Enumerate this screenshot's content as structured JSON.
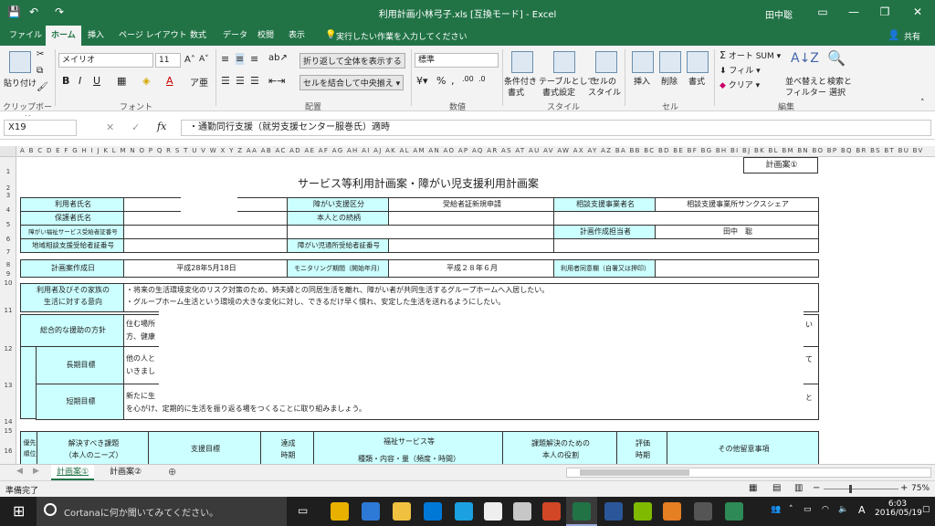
{
  "titlebar": {
    "title": "利用計画小林弓子.xls [互換モード] - Excel",
    "user": "田中聡"
  },
  "tabs": [
    "ファイル",
    "ホーム",
    "挿入",
    "ページ レイアウト",
    "数式",
    "データ",
    "校閲",
    "表示"
  ],
  "tell_me": "実行したい作業を入力してください",
  "share": "共有",
  "ribbon": {
    "paste": "貼り付け",
    "clipboard": "クリップボード",
    "font_name": "メイリオ",
    "font_size": "11",
    "font_group": "フォント",
    "wrap": "折り返して全体を表示する",
    "merge": "セルを結合して中央揃え",
    "align_group": "配置",
    "number_format": "標準",
    "number_group": "数値",
    "cond": "条件付き",
    "cond2": "書式",
    "table": "テーブルとして",
    "table2": "書式設定",
    "cellstyle": "セルの",
    "cellstyle2": "スタイル",
    "style_group": "スタイル",
    "insert": "挿入",
    "delete": "削除",
    "format": "書式",
    "cells_group": "セル",
    "autosum": "オート SUM",
    "fill": "フィル",
    "clear": "クリア",
    "sort": "並べ替えと",
    "sort2": "フィルター",
    "find": "検索と",
    "find2": "選択",
    "edit_group": "編集"
  },
  "formula": {
    "name_box": "X19",
    "fx": "fx",
    "value": "・通勤同行支援（就労支援センター服巻氏）適時"
  },
  "col_headers": "A B C D E F G H I J K L M N O P Q R S T U V W X Y Z AA AB AC AD AE AF AG AH AI AJ AK AL AM AN AO AP AQ AR AS AT AU AV AW AX AY AZ BA BB BC BD BE BF BG BH BI BJ BK BL BM BN BO BP BQ BR BS BT BU BV",
  "rows": [
    "1",
    "2",
    "3",
    "4",
    "5",
    "6",
    "7",
    "8",
    "9",
    "10",
    "11",
    "12",
    "13",
    "14",
    "15",
    "16"
  ],
  "sheet": {
    "plan_label": "計画案①",
    "title": "サービス等利用計画案・障がい児支援利用計画案",
    "user_name": "利用者氏名",
    "guardian": "保護者氏名",
    "welfare_no": "障がい福祉サービス受給者証番号",
    "consult_no": "地域相談支援受給者証番号",
    "disability": "障がい支援区分",
    "applicant": "受給者証新規申請",
    "relation": "本人との続柄",
    "child_no": "障がい児通所受給者証番号",
    "office_label": "相談支援事業者名",
    "office": "相談支援事業所サンクスシェア",
    "planner_label": "計画作成担当者",
    "planner": "田中　聡",
    "date_label": "計画案作成日",
    "date": "平成28年5月18日",
    "monitor_label": "モニタリング期間（開始年月）",
    "monitor": "平成２８年６月",
    "consent": "利用者同意欄（自署又は押印）",
    "intent_label1": "利用者及びその家族の",
    "intent_label2": "生活に対する意向",
    "intent1": "・将来の生活環境変化のリスク対策のため、姉夫婦との同居生活を離れ、障がい者が共同生活するグループホームへ入居したい。",
    "intent2": "・グループホーム生活という環境の大きな変化に対し、できるだけ早く慣れ、安定した生活を送れるようにしたい。",
    "policy_label": "総合的な援助の方針",
    "policy1": "住む場所",
    "policy2": "方、健康",
    "policy_end": "い",
    "long_label": "長期目標",
    "long1": "他の人と",
    "long2": "いきまし",
    "long_end": "て",
    "short_label": "短期目標",
    "short1": "新たに生",
    "short2": "を心がけ、定期的に生活を振り返る場をつくることに取り組みましょう。",
    "short_end": "と",
    "h_priority": "優先順位",
    "h_issue1": "解決すべき課題",
    "h_issue2": "（本人のニーズ）",
    "h_goal": "支援目標",
    "h_period1": "達成",
    "h_period2": "時期",
    "h_service1": "福祉サービス等",
    "h_service2": "種類・内容・量（頻度・時間）",
    "h_role1": "課題解決のための",
    "h_role2": "本人の役割",
    "h_eval1": "評価",
    "h_eval2": "時期",
    "h_other": "その他留意事項"
  },
  "sheet_tabs": [
    "計画案①",
    "計画案②"
  ],
  "status": {
    "ready": "準備完了",
    "zoom": "75%"
  },
  "taskbar": {
    "cortana": "Cortanaに何か聞いてみてください。",
    "time": "6:03",
    "date": "2016/05/19",
    "ime": "A"
  }
}
